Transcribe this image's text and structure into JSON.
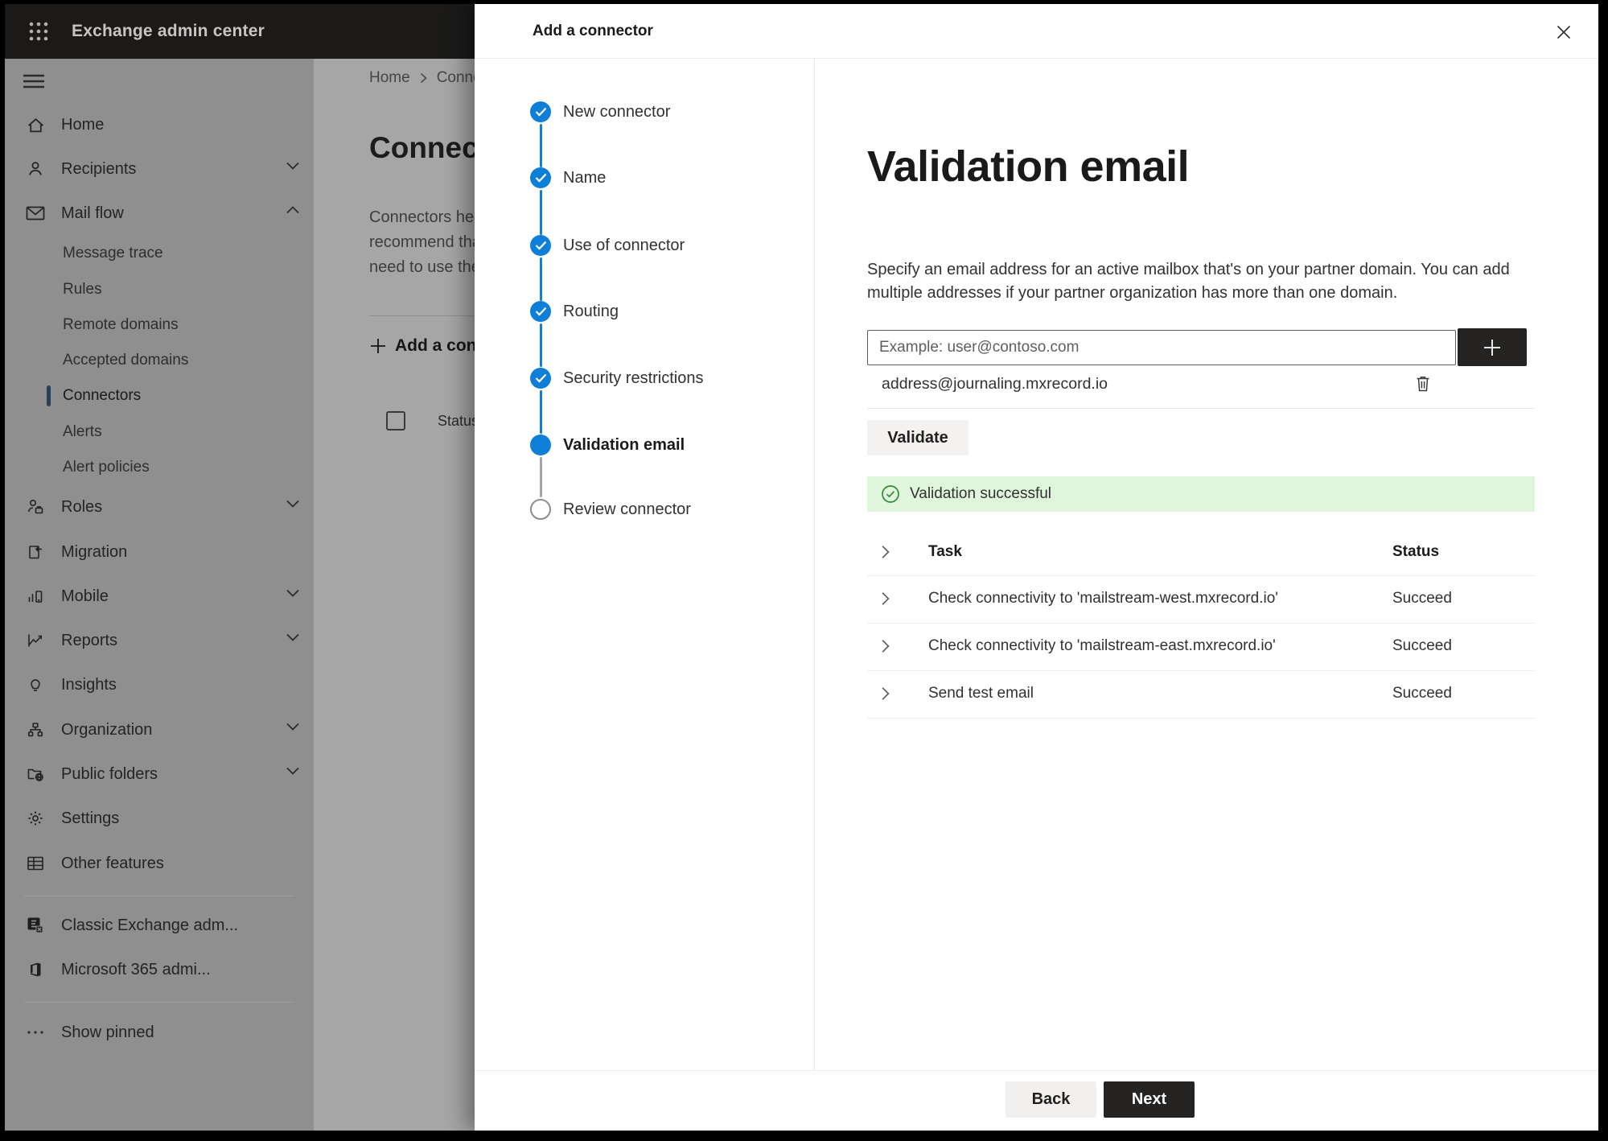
{
  "app": {
    "title": "Exchange admin center"
  },
  "sidebar": {
    "items": [
      {
        "label": "Home"
      },
      {
        "label": "Recipients"
      },
      {
        "label": "Mail flow"
      },
      {
        "label": "Message trace"
      },
      {
        "label": "Rules"
      },
      {
        "label": "Remote domains"
      },
      {
        "label": "Accepted domains"
      },
      {
        "label": "Connectors"
      },
      {
        "label": "Alerts"
      },
      {
        "label": "Alert policies"
      },
      {
        "label": "Roles"
      },
      {
        "label": "Migration"
      },
      {
        "label": "Mobile"
      },
      {
        "label": "Reports"
      },
      {
        "label": "Insights"
      },
      {
        "label": "Organization"
      },
      {
        "label": "Public folders"
      },
      {
        "label": "Settings"
      },
      {
        "label": "Other features"
      },
      {
        "label": "Classic Exchange adm..."
      },
      {
        "label": "Microsoft 365 admi..."
      },
      {
        "label": "Show pinned"
      }
    ]
  },
  "page": {
    "breadcrumb_home": "Home",
    "breadcrumb_current": "Connec",
    "heading": "Connect",
    "para_line1": "Connectors help",
    "para_line2": "recommend that",
    "para_line3": "need to use ther",
    "add_button": "Add a conn",
    "status_header": "Status"
  },
  "panel": {
    "title": "Add a connector",
    "steps": [
      {
        "label": "New connector",
        "state": "done"
      },
      {
        "label": "Name",
        "state": "done"
      },
      {
        "label": "Use of connector",
        "state": "done"
      },
      {
        "label": "Routing",
        "state": "done"
      },
      {
        "label": "Security restrictions",
        "state": "done"
      },
      {
        "label": "Validation email",
        "state": "current"
      },
      {
        "label": "Review connector",
        "state": "pending"
      }
    ],
    "content": {
      "title": "Validation email",
      "desc_line1": "Specify an email address for an active mailbox that's on your partner domain. You can add",
      "desc_line2": "multiple addresses if your partner organization has more than one domain.",
      "email_placeholder": "Example: user@contoso.com",
      "email_value": "",
      "address": "address@journaling.mxrecord.io",
      "validate_button": "Validate",
      "banner_text": "Validation successful",
      "table": {
        "header_task": "Task",
        "header_status": "Status",
        "rows": [
          {
            "task": "Check connectivity to 'mailstream-west.mxrecord.io'",
            "status": "Succeed"
          },
          {
            "task": "Check connectivity to 'mailstream-east.mxrecord.io'",
            "status": "Succeed"
          },
          {
            "task": "Send test email",
            "status": "Succeed"
          }
        ]
      }
    },
    "footer": {
      "back": "Back",
      "next": "Next"
    }
  },
  "icons": {
    "app_launcher": "waffle-grid",
    "menu": "hamburger",
    "step_done": "check-circle",
    "success": "check-circle-outline",
    "add": "plus",
    "delete": "trash",
    "close": "x",
    "expand": "chevron-right",
    "collapse_up": "chevron-up",
    "expand_down": "chevron-down"
  },
  "colors": {
    "accent_blue": "#0e7fd9",
    "success_bg": "#dff6dd",
    "success_icon": "#2f8a2f",
    "primary_button": "#252423",
    "panel_bg": "#ffffff",
    "appbar_bg": "#1b1a19"
  }
}
